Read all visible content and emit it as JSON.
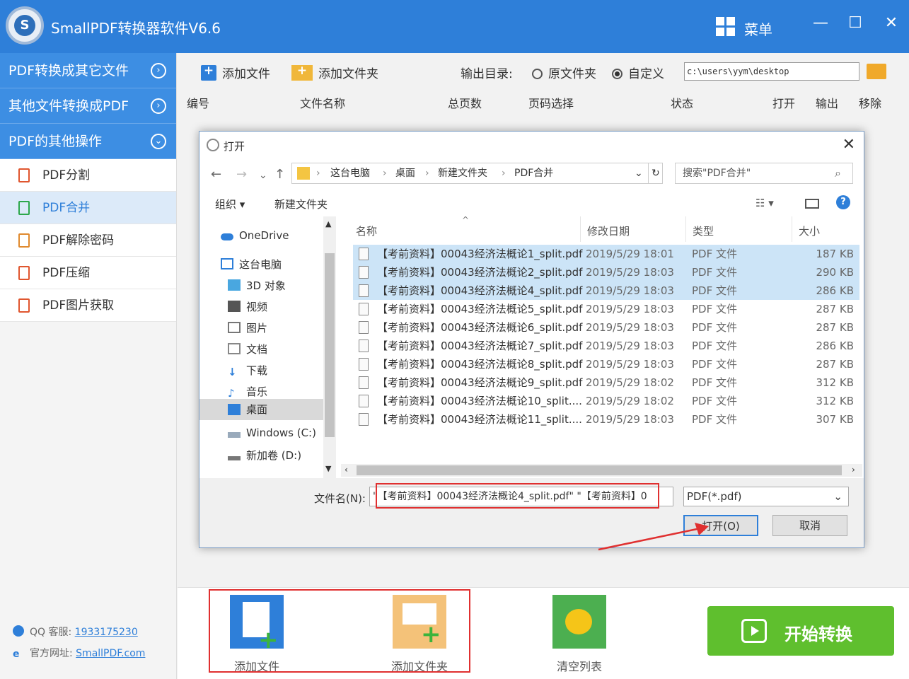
{
  "app": {
    "title": "SmallPDF转换器软件V6.6",
    "logo_letter": "S",
    "menu_label": "菜单"
  },
  "window_controls": {
    "minimize": "—",
    "maximize": "☐",
    "close": "✕"
  },
  "sidebar": {
    "categories": [
      {
        "label": "PDF转换成其它文件",
        "icon": "chevron-right-icon"
      },
      {
        "label": "其他文件转换成PDF",
        "icon": "chevron-right-icon"
      },
      {
        "label": "PDF的其他操作",
        "icon": "chevron-down-icon"
      }
    ],
    "items": [
      {
        "label": "PDF分割",
        "active": false
      },
      {
        "label": "PDF合并",
        "active": true
      },
      {
        "label": "PDF解除密码",
        "active": false
      },
      {
        "label": "PDF压缩",
        "active": false
      },
      {
        "label": "PDF图片获取",
        "active": false
      }
    ],
    "support": {
      "label": "QQ 客服:",
      "value": "1933175230"
    },
    "website": {
      "label": "官方网址:",
      "value": "SmallPDF.com"
    }
  },
  "toolbar": {
    "add_file": "添加文件",
    "add_folder": "添加文件夹",
    "output_label": "输出目录:",
    "option_source": "原文件夹",
    "option_custom": "自定义",
    "selected_option": "自定义",
    "output_path": "c:\\users\\yym\\desktop"
  },
  "table_headers": [
    "编号",
    "文件名称",
    "总页数",
    "页码选择",
    "状态",
    "打开",
    "输出",
    "移除"
  ],
  "dialog": {
    "title": "打开",
    "breadcrumb": [
      "这台电脑",
      "桌面",
      "新建文件夹",
      "PDF合并"
    ],
    "search_placeholder": "搜索\"PDF合并\"",
    "organize": "组织 ▾",
    "new_folder": "新建文件夹",
    "nav": [
      {
        "label": "OneDrive",
        "icon": "cloud-icon"
      },
      {
        "label": "这台电脑",
        "icon": "computer-icon"
      },
      {
        "label": "3D 对象",
        "icon": "cube-icon"
      },
      {
        "label": "视频",
        "icon": "video-icon"
      },
      {
        "label": "图片",
        "icon": "picture-icon"
      },
      {
        "label": "文档",
        "icon": "document-icon"
      },
      {
        "label": "下载",
        "icon": "download-icon"
      },
      {
        "label": "音乐",
        "icon": "music-icon"
      },
      {
        "label": "桌面",
        "icon": "desktop-icon"
      },
      {
        "label": "Windows (C:)",
        "icon": "drive-icon"
      },
      {
        "label": "新加卷 (D:)",
        "icon": "drive-icon"
      }
    ],
    "columns": {
      "name": "名称",
      "date": "修改日期",
      "type": "类型",
      "size": "大小"
    },
    "files": [
      {
        "name": "【考前资料】00043经济法概论1_split.pdf",
        "date": "2019/5/29 18:01",
        "type": "PDF 文件",
        "size": "187 KB",
        "selected": true
      },
      {
        "name": "【考前资料】00043经济法概论2_split.pdf",
        "date": "2019/5/29 18:03",
        "type": "PDF 文件",
        "size": "290 KB",
        "selected": true
      },
      {
        "name": "【考前资料】00043经济法概论4_split.pdf",
        "date": "2019/5/29 18:03",
        "type": "PDF 文件",
        "size": "286 KB",
        "selected": true
      },
      {
        "name": "【考前资料】00043经济法概论5_split.pdf",
        "date": "2019/5/29 18:03",
        "type": "PDF 文件",
        "size": "287 KB",
        "selected": false
      },
      {
        "name": "【考前资料】00043经济法概论6_split.pdf",
        "date": "2019/5/29 18:03",
        "type": "PDF 文件",
        "size": "287 KB",
        "selected": false
      },
      {
        "name": "【考前资料】00043经济法概论7_split.pdf",
        "date": "2019/5/29 18:03",
        "type": "PDF 文件",
        "size": "286 KB",
        "selected": false
      },
      {
        "name": "【考前资料】00043经济法概论8_split.pdf",
        "date": "2019/5/29 18:03",
        "type": "PDF 文件",
        "size": "287 KB",
        "selected": false
      },
      {
        "name": "【考前资料】00043经济法概论9_split.pdf",
        "date": "2019/5/29 18:02",
        "type": "PDF 文件",
        "size": "312 KB",
        "selected": false
      },
      {
        "name": "【考前资料】00043经济法概论10_split....",
        "date": "2019/5/29 18:02",
        "type": "PDF 文件",
        "size": "312 KB",
        "selected": false
      },
      {
        "name": "【考前资料】00043经济法概论11_split....",
        "date": "2019/5/29 18:03",
        "type": "PDF 文件",
        "size": "307 KB",
        "selected": false
      }
    ],
    "filename_label": "文件名(N):",
    "filename_value": "\"【考前资料】00043经济法概论4_split.pdf\" \"【考前资料】0",
    "filter_value": "PDF(*.pdf)",
    "open_button": "打开(O)",
    "cancel_button": "取消"
  },
  "bottom": {
    "add_file": "添加文件",
    "add_folder": "添加文件夹",
    "clear_list": "清空列表",
    "start": "开始转换"
  },
  "colors": {
    "brand_blue": "#2e7fd9",
    "start_green": "#5fbf2e",
    "annotation_red": "#e03030",
    "selection": "#cce4f7"
  }
}
